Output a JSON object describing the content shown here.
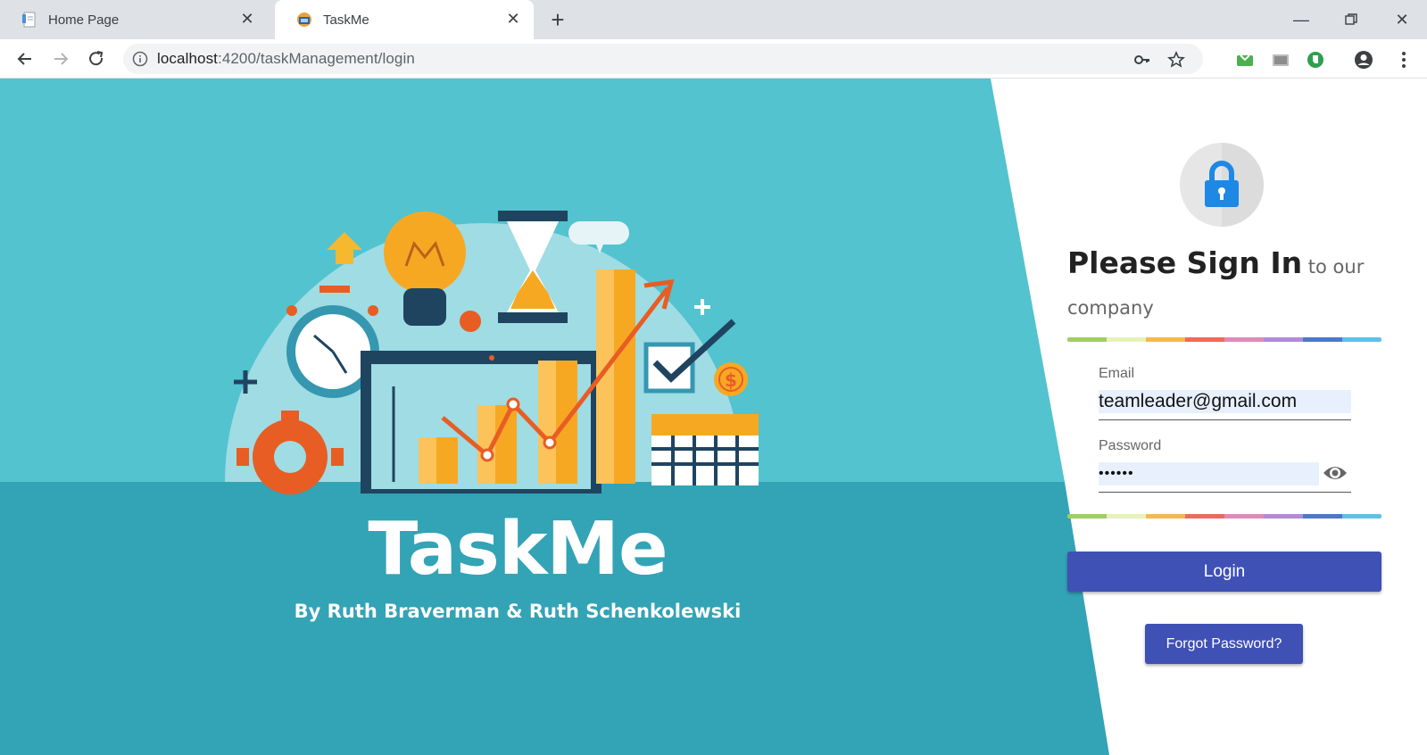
{
  "browser": {
    "tabs": [
      {
        "title": "Home Page",
        "active": false
      },
      {
        "title": "TaskMe",
        "active": true
      }
    ],
    "url_host": "localhost",
    "url_path": ":4200/taskManagement/login"
  },
  "hero": {
    "title": "TaskMe",
    "subtitle": "By Ruth Braverman & Ruth Schenkolewski"
  },
  "login": {
    "title_main": "Please Sign In",
    "title_rest": " to our company",
    "email_label": "Email",
    "email_value": "teamleader@gmail.com",
    "password_label": "Password",
    "password_value": "••••••",
    "login_button": "Login",
    "forgot_button": "Forgot Password?"
  },
  "colors": {
    "hero_top": "#52c3cf",
    "hero_bottom": "#33a3b6",
    "button": "#3f51b5",
    "rainbow": [
      "#9fce63",
      "#e6f2b8",
      "#f8b84e",
      "#ee6a5a",
      "#e08ab9",
      "#b389d9",
      "#4b79c8",
      "#5ec1e6"
    ]
  }
}
